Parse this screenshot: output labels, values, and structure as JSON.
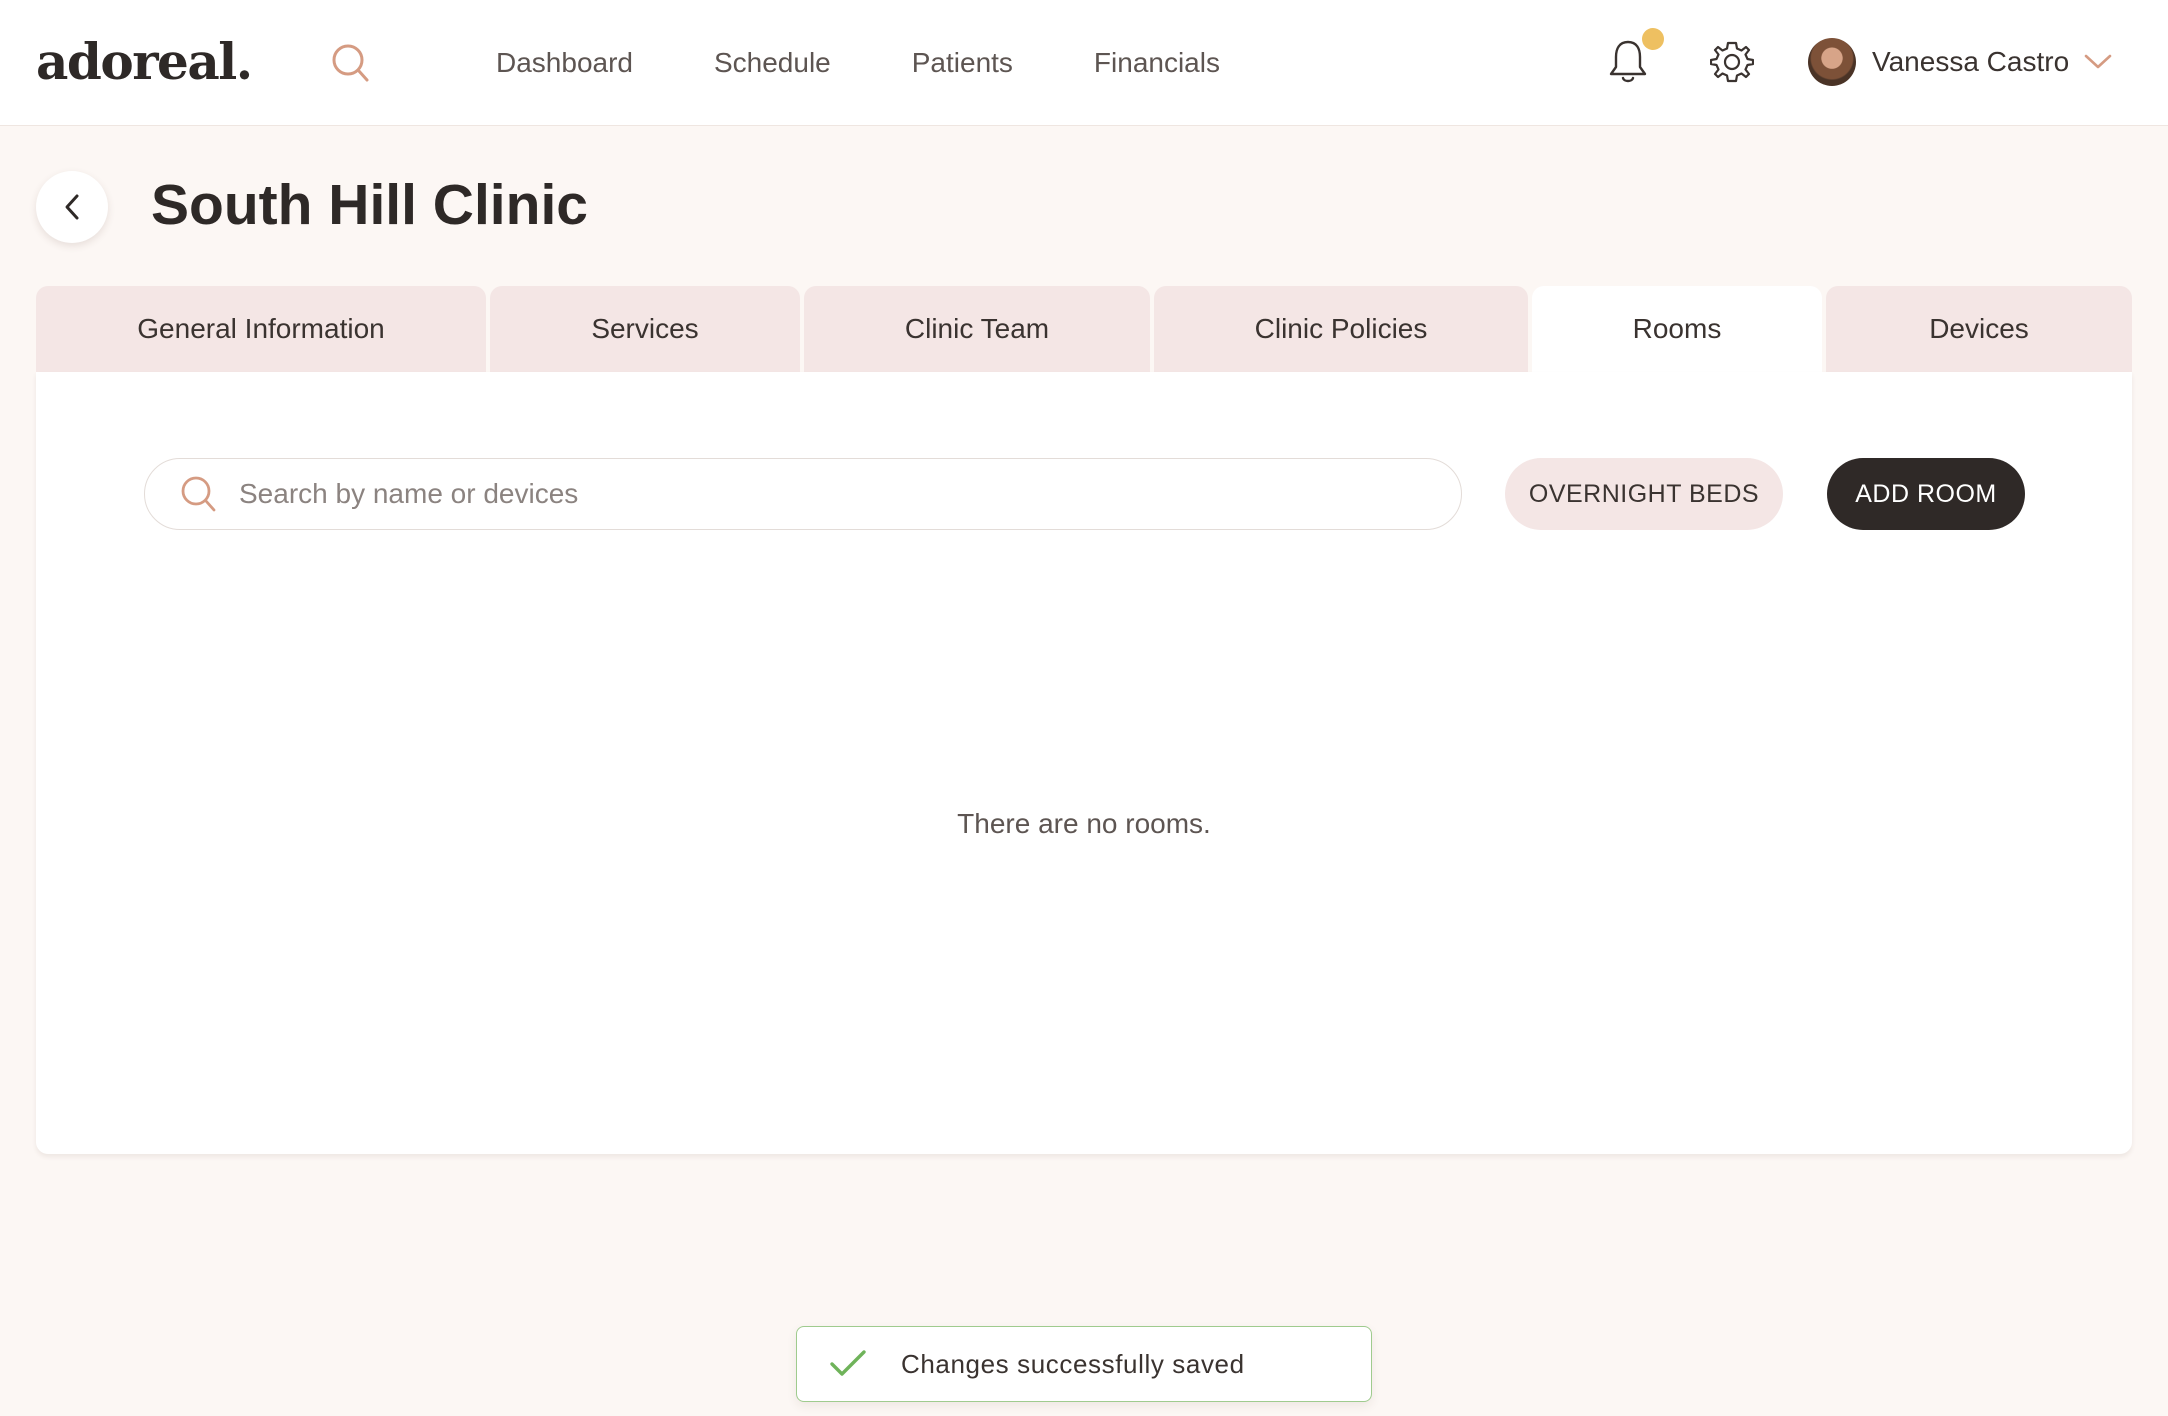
{
  "app": {
    "logo": "adoreal."
  },
  "nav": {
    "items": [
      {
        "label": "Dashboard"
      },
      {
        "label": "Schedule"
      },
      {
        "label": "Patients"
      },
      {
        "label": "Financials"
      }
    ]
  },
  "user": {
    "name": "Vanessa Castro"
  },
  "notifications": {
    "has_unread": true,
    "dot_color": "#eec061"
  },
  "page": {
    "title": "South Hill Clinic"
  },
  "tabs": [
    {
      "label": "General Information",
      "active": false
    },
    {
      "label": "Services",
      "active": false
    },
    {
      "label": "Clinic Team",
      "active": false
    },
    {
      "label": "Clinic Policies",
      "active": false
    },
    {
      "label": "Rooms",
      "active": true
    },
    {
      "label": "Devices",
      "active": false
    }
  ],
  "rooms": {
    "search_placeholder": "Search by name or devices",
    "search_value": "",
    "overnight_label": "OVERNIGHT BEDS",
    "add_label": "ADD ROOM",
    "empty_message": "There are no rooms."
  },
  "toast": {
    "message": "Changes successfully saved",
    "accent_color": "#6fb35a"
  },
  "colors": {
    "accent": "#d59b82",
    "tab_bg": "#f4e6e5",
    "dark_button": "#2f2927",
    "page_bg": "#fcf7f4"
  }
}
